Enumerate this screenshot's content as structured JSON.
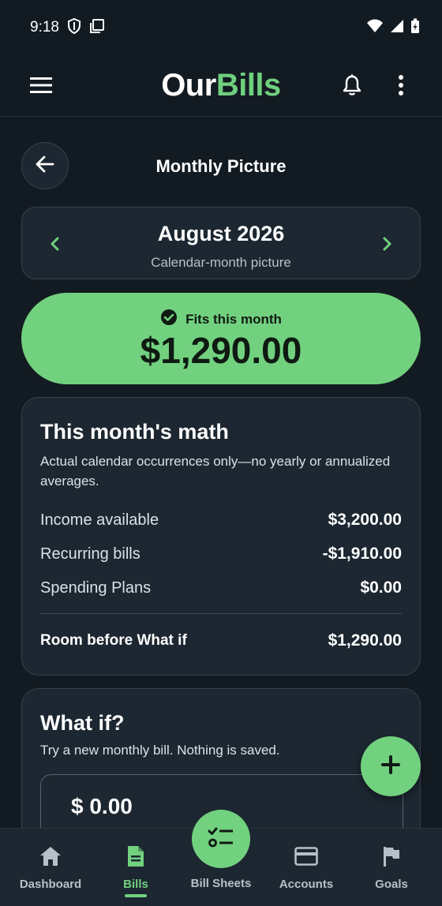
{
  "status_bar": {
    "time": "9:18"
  },
  "app_bar": {
    "brand_part1": "Our",
    "brand_part2": "Bills"
  },
  "page": {
    "title": "Monthly Picture"
  },
  "month_selector": {
    "month": "August 2026",
    "subtitle": "Calendar-month picture"
  },
  "fits_banner": {
    "label": "Fits this month",
    "amount": "$1,290.00"
  },
  "math_card": {
    "title": "This month's math",
    "description": "Actual calendar occurrences only—no yearly or annualized averages.",
    "rows": [
      {
        "label": "Income available",
        "value": "$3,200.00"
      },
      {
        "label": "Recurring bills",
        "value": "-$1,910.00"
      },
      {
        "label": "Spending Plans",
        "value": "$0.00"
      }
    ],
    "total": {
      "label": "Room before What if",
      "value": "$1,290.00"
    }
  },
  "whatif_card": {
    "title": "What if?",
    "description": "Try a new monthly bill. Nothing is saved.",
    "amount_value": "$ 0.00"
  },
  "bottom_nav": {
    "items": [
      {
        "label": "Dashboard"
      },
      {
        "label": "Bills"
      },
      {
        "label": "Bill Sheets"
      },
      {
        "label": "Accounts"
      },
      {
        "label": "Goals"
      }
    ],
    "active_index": 1
  },
  "colors": {
    "accent": "#72d17f",
    "background": "#131b22",
    "card": "#1c2731"
  }
}
